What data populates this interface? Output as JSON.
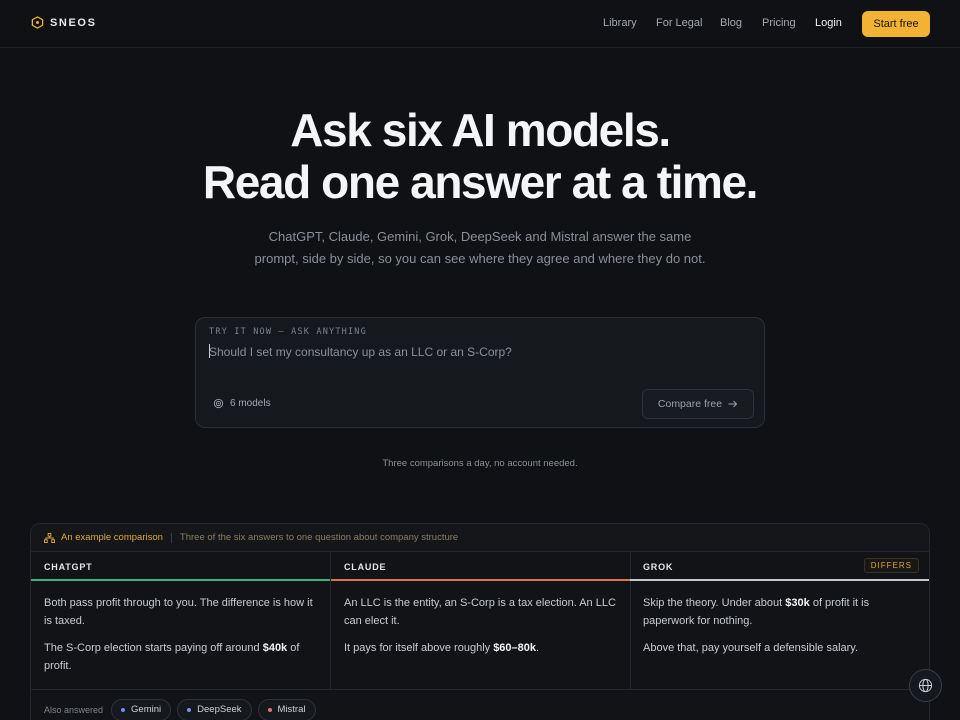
{
  "brand": {
    "name": "SNEOS",
    "accent": "#f2b233"
  },
  "nav": {
    "links": [
      "Library",
      "For Legal",
      "Blog",
      "Pricing"
    ],
    "login": "Login",
    "cta": "Start free"
  },
  "hero": {
    "title_line1": "Ask six AI models.",
    "title_line2": "Read one answer at a time.",
    "subtitle": "ChatGPT, Claude, Gemini, Grok, DeepSeek and Mistral answer the same prompt, side by side, so you can see where they agree and where they do not."
  },
  "prompt": {
    "label": "TRY IT NOW — ASK ANYTHING",
    "placeholder": "Should I set my consultancy up as an LLC or an S-Corp?",
    "models": "6 models",
    "compare": "Compare free",
    "note": "Three comparisons a day, no account needed."
  },
  "comparison": {
    "heading": "An example comparison",
    "description": "Three of the six answers to one question about company structure",
    "columns": [
      {
        "name": "CHATGPT",
        "color": "#3fae7d",
        "p1": "Both pass profit through to you. The difference is how it is taxed.",
        "p2_pre": "The S-Corp election starts paying off around ",
        "p2_bold": "$40k",
        "p2_post": " of profit."
      },
      {
        "name": "CLAUDE",
        "color": "#d9764a",
        "p1": "An LLC is the entity, an S-Corp is a tax election. An LLC can elect it.",
        "p2_pre": "It pays for itself above roughly ",
        "p2_bold": "$60–80k",
        "p2_post": "."
      },
      {
        "name": "GROK",
        "color": "#c4c7cc",
        "badge": "DIFFERS",
        "p1_pre": "Skip the theory. Under about ",
        "p1_bold": "$30k",
        "p1_post": " of profit it is paperwork for nothing.",
        "p2": "Above that, pay yourself a defensible salary."
      }
    ],
    "also_label": "Also answered",
    "also": [
      {
        "name": "Gemini",
        "color": "#6b8cf2"
      },
      {
        "name": "DeepSeek",
        "color": "#7b93e6"
      },
      {
        "name": "Mistral",
        "color": "#e0707a"
      }
    ]
  }
}
